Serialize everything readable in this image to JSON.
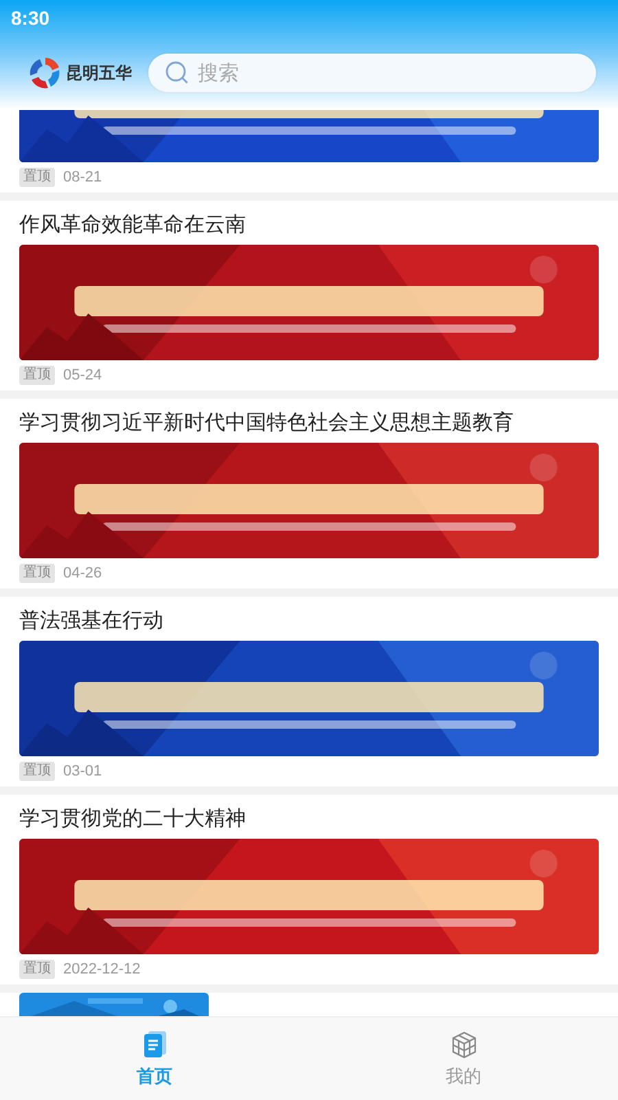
{
  "status_bar": {
    "time": "8:30"
  },
  "header": {
    "logo_text": "昆明五华",
    "search": {
      "placeholder": "搜索"
    }
  },
  "articles": [
    {
      "tag": "置顶",
      "date": "08-21"
    },
    {
      "title": "作风革命效能革命在云南",
      "tag": "置顶",
      "date": "05-24"
    },
    {
      "title": "学习贯彻习近平新时代中国特色社会主义思想主题教育",
      "tag": "置顶",
      "date": "04-26"
    },
    {
      "title": "普法强基在行动",
      "tag": "置顶",
      "date": "03-01"
    },
    {
      "title": "学习贯彻党的二十大精神",
      "tag": "置顶",
      "date": "2022-12-12"
    }
  ],
  "tab_bar": [
    {
      "label": "首页",
      "selected": true
    },
    {
      "label": "我的",
      "selected": false
    }
  ]
}
